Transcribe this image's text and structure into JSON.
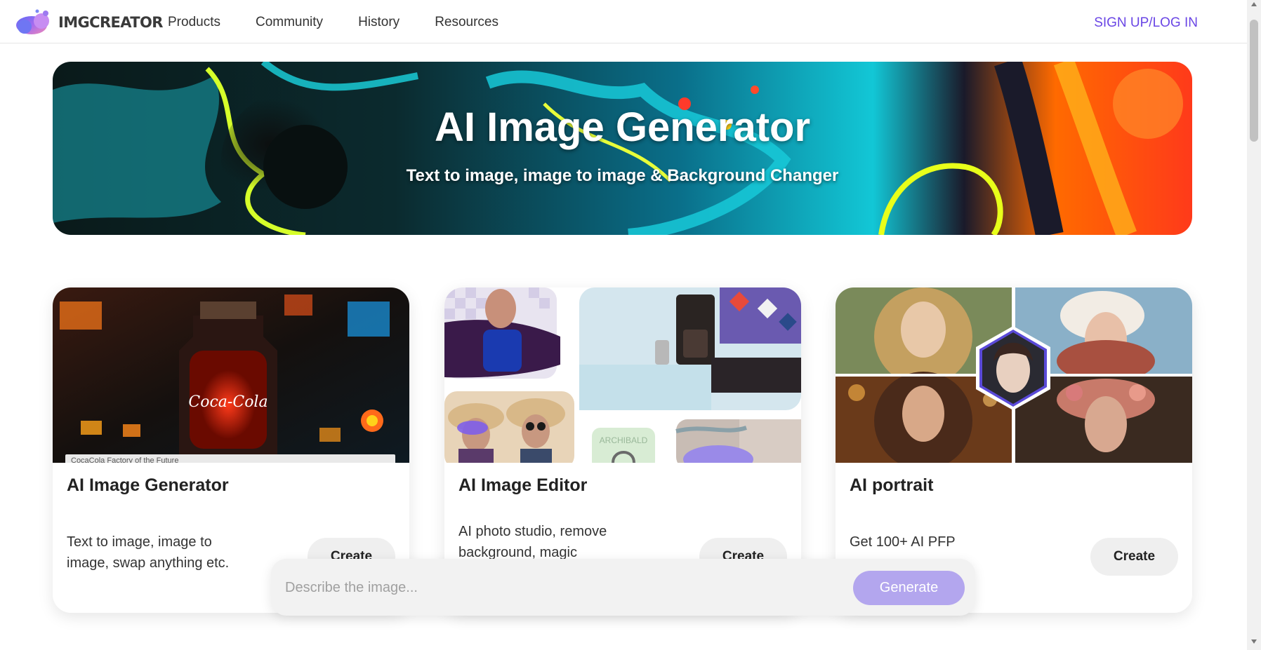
{
  "header": {
    "logo_text": "IMGCREATOR",
    "nav": [
      "Products",
      "Community",
      "History",
      "Resources"
    ],
    "login_label": "SIGN UP/LOG IN"
  },
  "hero": {
    "title": "AI Image Generator",
    "subtitle": "Text to image, image to image & Background Changer"
  },
  "cards": [
    {
      "title": "AI Image Generator",
      "description": "Text to image, image to image, swap anything etc.",
      "button": "Create",
      "image_caption": "CocaCola Factory of the Future",
      "image_text": "Coca-Cola"
    },
    {
      "title": "AI Image Editor",
      "description": "AI photo studio, remove background, magic",
      "button": "Create",
      "image_text": "ARCHIBALD"
    },
    {
      "title": "AI portrait",
      "description": "Get 100+ AI PFP",
      "button": "Create"
    }
  ],
  "prompt": {
    "placeholder": "Describe the image...",
    "button": "Generate"
  },
  "colors": {
    "accent": "#6a46e5",
    "generate_button": "#b3a6ee"
  }
}
